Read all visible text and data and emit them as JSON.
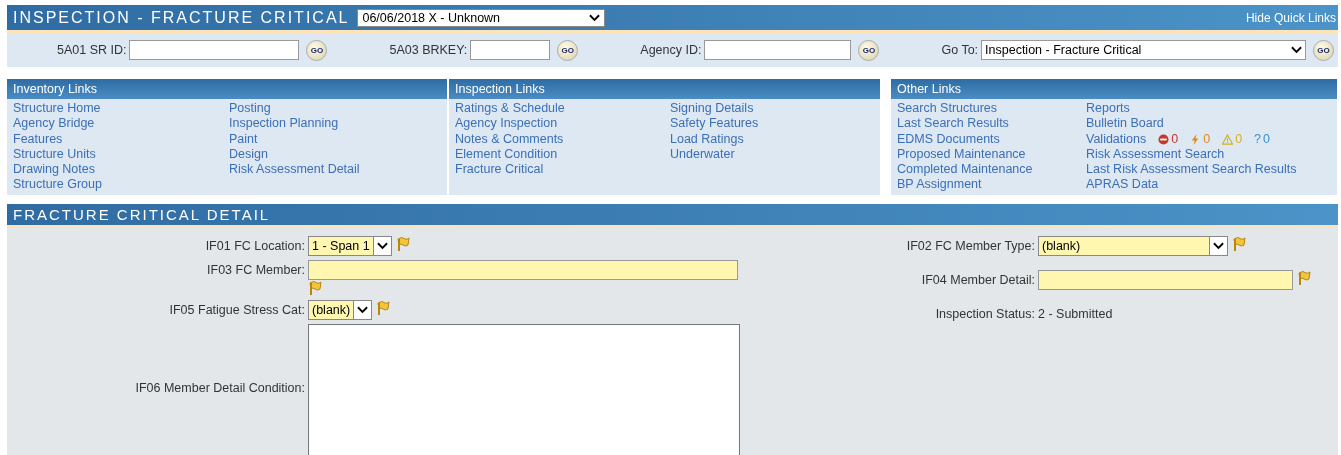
{
  "header": {
    "title": "INSPECTION - FRACTURE CRITICAL",
    "inspection_select": {
      "value": "06/06/2018 X - Unknown"
    },
    "hide_links": "Hide Quick Links"
  },
  "search": [
    {
      "kind": "text",
      "label": "5A01 SR ID:",
      "go": "GO"
    },
    {
      "kind": "text",
      "label": "5A03 BRKEY:",
      "go": "GO"
    },
    {
      "kind": "text",
      "label": "Agency ID:",
      "go": "GO"
    },
    {
      "kind": "select",
      "label": "Go To:",
      "value": "Inspection - Fracture Critical",
      "go": "GO"
    }
  ],
  "link_panels": [
    {
      "title": "Inventory Links",
      "columns": [
        [
          {
            "kind": "link",
            "label": "Structure Home"
          },
          {
            "kind": "link",
            "label": "Agency Bridge"
          },
          {
            "kind": "link",
            "label": "Features"
          },
          {
            "kind": "link",
            "label": "Structure Units"
          },
          {
            "kind": "link",
            "label": "Drawing Notes"
          },
          {
            "kind": "link",
            "label": "Structure Group"
          }
        ],
        [
          {
            "kind": "link",
            "label": "Posting"
          },
          {
            "kind": "link",
            "label": "Inspection Planning"
          },
          {
            "kind": "link",
            "label": "Paint"
          },
          {
            "kind": "link",
            "label": "Design"
          },
          {
            "kind": "link",
            "label": "Risk Assessment Detail"
          }
        ]
      ]
    },
    {
      "title": "Inspection Links",
      "columns": [
        [
          {
            "kind": "link",
            "label": "Ratings & Schedule"
          },
          {
            "kind": "link",
            "label": "Agency Inspection"
          },
          {
            "kind": "link",
            "label": "Notes & Comments"
          },
          {
            "kind": "link",
            "label": "Element Condition"
          },
          {
            "kind": "link",
            "label": "Fracture Critical"
          }
        ],
        [
          {
            "kind": "link",
            "label": "Signing Details"
          },
          {
            "kind": "link",
            "label": "Safety Features"
          },
          {
            "kind": "link",
            "label": "Load Ratings"
          },
          {
            "kind": "link",
            "label": "Underwater"
          }
        ]
      ]
    },
    {
      "title": "Other Links",
      "columns": [
        [
          {
            "kind": "link",
            "label": "Search Structures"
          },
          {
            "kind": "link",
            "label": "Last Search Results"
          },
          {
            "kind": "link",
            "label": "EDMS Documents"
          },
          {
            "kind": "link",
            "label": "Proposed Maintenance"
          },
          {
            "kind": "link",
            "label": "Completed Maintenance"
          },
          {
            "kind": "link",
            "label": "BP Assignment"
          }
        ],
        [
          {
            "kind": "link",
            "label": "Reports"
          },
          {
            "kind": "link",
            "label": "Bulletin Board"
          },
          {
            "kind": "validations",
            "label": "Validations",
            "counts": [
              {
                "kind": "error",
                "count": "0"
              },
              {
                "kind": "fatal",
                "count": "0"
              },
              {
                "kind": "warning",
                "count": "0"
              },
              {
                "kind": "question",
                "symbol": "?",
                "count": "0"
              }
            ]
          },
          {
            "kind": "link",
            "label": "Risk Assessment Search"
          },
          {
            "kind": "link",
            "label": "Last Risk Assessment Search Results"
          },
          {
            "kind": "link",
            "label": "APRAS Data"
          }
        ]
      ]
    }
  ],
  "section": {
    "title": "FRACTURE CRITICAL DETAIL",
    "left": [
      {
        "kind": "select",
        "label": "IF01 FC Location:",
        "value": "1 - Span 1",
        "required": true,
        "flag": true
      },
      {
        "kind": "text",
        "label": "IF03 FC Member:",
        "required": true,
        "flag": true
      },
      {
        "kind": "select",
        "label": "IF05 Fatigue Stress Cat:",
        "value": "(blank)",
        "required": true,
        "flag": true
      },
      {
        "kind": "textarea",
        "label": "IF06 Member Detail Condition:",
        "required": false,
        "flag": false
      }
    ],
    "right": [
      {
        "kind": "select",
        "label": "IF02 FC Member Type:",
        "value": "(blank)",
        "required": true,
        "flag": true
      },
      {
        "kind": "text",
        "label": "IF04 Member Detail:",
        "required": true,
        "flag": true
      },
      {
        "kind": "readonly",
        "label": "Inspection Status:",
        "value": "2 - Submitted"
      }
    ]
  }
}
